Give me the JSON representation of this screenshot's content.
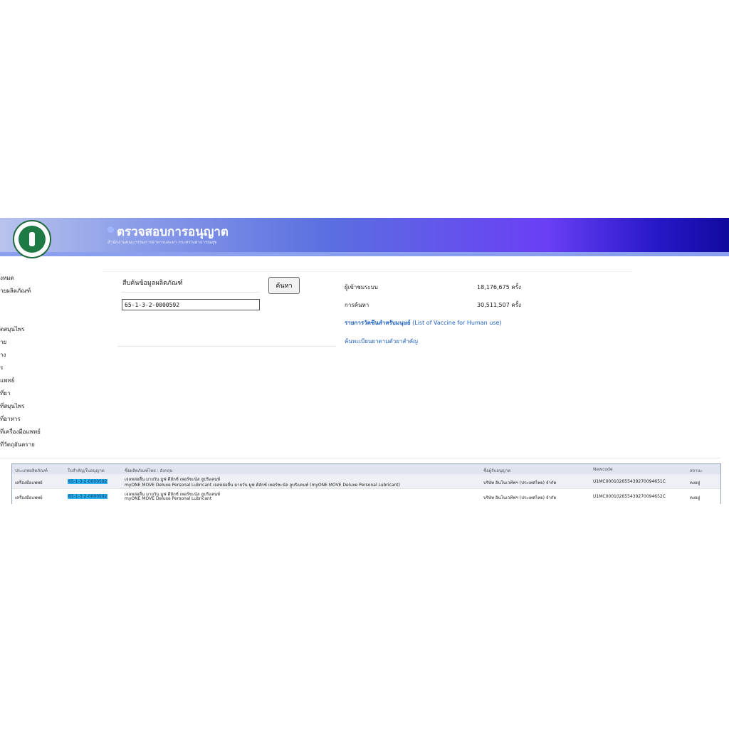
{
  "header": {
    "title": "ตรวจสอบการอนุญาต",
    "subtitle": "สำนักงานคณะกรรมการอาหารและยา กระทรวงสาธารณสุข"
  },
  "sidebar": {
    "items": [
      "ั้งหมด",
      "ายผลิตภัณฑ์",
      "ิตสมุนไพร",
      "าย",
      "าง",
      "ร",
      "แพทย์",
      "ที่ยา",
      "ที่สมุนไพร",
      "ที่อาหาร",
      "ที่เครื่องมือแพทย์",
      "ที่วัตถุอันตราย"
    ]
  },
  "search": {
    "label": "สืบค้นข้อมูลผลิตภัณฑ์",
    "value": "65-1-3-2-0000592",
    "button": "ค้นหา"
  },
  "stats": {
    "visitors_label": "ผู้เข้าชมระบบ",
    "visitors_value": "18,176,675 ครั้ง",
    "searches_label": "การค้นหา",
    "searches_value": "30,511,507 ครั้ง"
  },
  "links": {
    "vaccine_th": "รายการวัคซีนสำหรับมนุษย์",
    "vaccine_en": " (List of Vaccine for Human use)",
    "register_search": "ค้นทะเบียนยาตามตัวยาสำคัญ"
  },
  "results": {
    "headers": [
      "ประเภทผลิตภัณฑ์",
      "ใบสำคัญ/ใบอนุญาต",
      "ชื่อผลิตภัณฑ์ไทย : อังกฤษ",
      "ชื่อผู้รับอนุญาต",
      "Newcode",
      "สถานะ"
    ],
    "rows": [
      {
        "type": "เครื่องมือแพทย์",
        "license": "65-1-3-2-0000592",
        "name_line1": "เจลหล่อลื่น มายวัน มูฟ ดีลักซ์ เพอร์ซะนัล ลูบริแคนท์",
        "name_line2": "myONE MOVE Deluxe Personal Lubricant เจลหล่อลื่น มายวัน มูฟ ดีลักซ์ เพอร์ซะนัล ลูบริแคนท์ (myONE MOVE Deluxe Personal Lubricant)",
        "licensee": "บริษัท อินโนเวทีฟฯ (ประเทศไทย) จำกัด",
        "newcode": "U1MC000102655439270094651C",
        "status": "คงอยู่"
      },
      {
        "type": "เครื่องมือแพทย์",
        "license": "65-1-3-2-0000592",
        "name_line1": "เจลหล่อลื่น มายวัน มูฟ ดีลักซ์ เพอร์ซะนัล ลูบริแคนท์",
        "name_line2": "myONE MOVE Deluxe Personal Lubricant",
        "licensee": "บริษัท อินโนเวทีฟฯ (ประเทศไทย) จำกัด",
        "newcode": "U1MC000102655439270094652C",
        "status": "คงอยู่"
      }
    ]
  },
  "colors": {
    "banner_start": "#b9c3ee",
    "banner_end": "#12099e",
    "link": "#1f5fbf",
    "highlight": "#2ab0e8"
  }
}
